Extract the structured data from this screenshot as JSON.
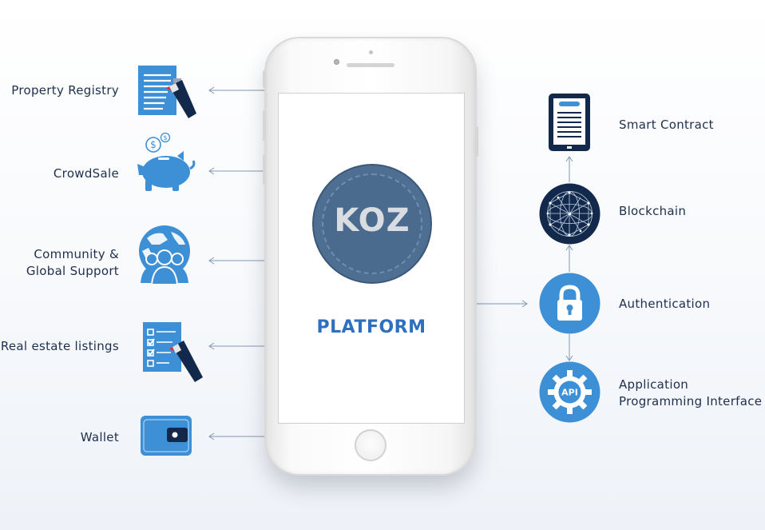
{
  "left_items": [
    {
      "label": "Property Registry",
      "icon": "document-pen-icon"
    },
    {
      "label": "CrowdSale",
      "icon": "piggy-bank-icon"
    },
    {
      "label": "Community &",
      "label_line2": "Global Support",
      "icon": "globe-people-icon"
    },
    {
      "label": "Real estate listings",
      "icon": "checklist-pen-icon"
    },
    {
      "label": "Wallet",
      "icon": "wallet-icon"
    }
  ],
  "right_items": [
    {
      "label": "Smart Contract",
      "icon": "tablet-document-icon"
    },
    {
      "label": "Blockchain",
      "icon": "network-sphere-icon"
    },
    {
      "label": "Authentication",
      "icon": "padlock-icon"
    },
    {
      "label": "Application",
      "label_line2": "Programming Interface",
      "icon": "api-gear-icon"
    }
  ],
  "phone": {
    "logo_text": "KOZ",
    "title": "PLATFORM"
  },
  "colors": {
    "icon_blue": "#3d8fd6",
    "navy": "#13294b",
    "label_text": "#1e2f4d",
    "platform_text": "#2f6fc0",
    "coin": "#4f6f92",
    "connector": "#7f98b4"
  }
}
